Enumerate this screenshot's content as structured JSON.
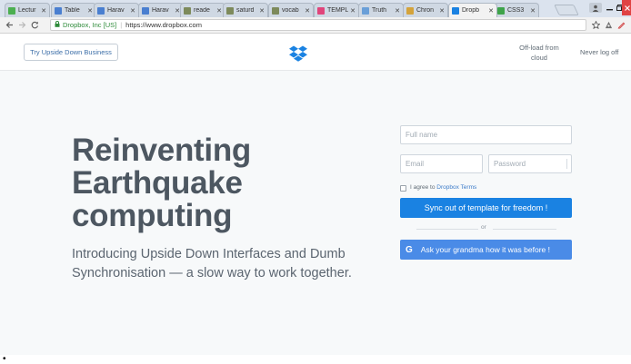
{
  "browser": {
    "tabs": [
      {
        "label": "Lectur",
        "color": "#4caf50"
      },
      {
        "label": "Table",
        "color": "#4a7fd0"
      },
      {
        "label": "Harav",
        "color": "#4a7fd0"
      },
      {
        "label": "Harav",
        "color": "#4a7fd0"
      },
      {
        "label": "reade",
        "color": "#7d8a5b"
      },
      {
        "label": "saturd",
        "color": "#7d8a5b"
      },
      {
        "label": "vocab",
        "color": "#7d8a5b"
      },
      {
        "label": "TEMPL",
        "color": "#e0457b"
      },
      {
        "label": "Truth",
        "color": "#6a9fd8"
      },
      {
        "label": "Chron",
        "color": "#d4a33b"
      },
      {
        "label": "Dropb",
        "color": "#1a82e2"
      },
      {
        "label": "CSS3",
        "color": "#3ea34a"
      }
    ],
    "close_glyph": "✕",
    "address": {
      "secure_label": "Dropbox, Inc [US]",
      "separator": "|",
      "url": "https://www.dropbox.com"
    }
  },
  "header": {
    "try_button": "Try Upside Down Business",
    "offload_link": "Off-load from cloud",
    "never_logoff_link": "Never log off",
    "brand_color": "#1a82e2"
  },
  "hero": {
    "headline": "Reinventing Earthquake computing",
    "subheadline": "Introducing Upside Down Interfaces and Dumb Synchronisation — a slow way to work together."
  },
  "form": {
    "fullname_placeholder": "Full name",
    "email_placeholder": "Email",
    "password_placeholder": "Password",
    "agree_prefix": "I agree to ",
    "agree_link": "Dropbox Terms",
    "submit_button": "Sync out of template for freedom !",
    "divider_text": "or",
    "google_letter": "G",
    "google_button": "Ask your grandma how it was before !"
  },
  "list_bullet": "•"
}
